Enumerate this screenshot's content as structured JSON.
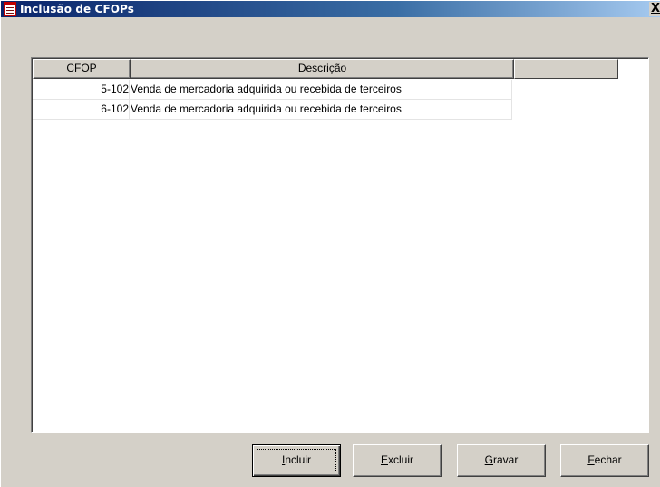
{
  "window": {
    "title": "Inclusão de CFOPs",
    "close_label": "X"
  },
  "table": {
    "columns": [
      "CFOP",
      "Descrição"
    ],
    "rows": [
      {
        "cfop": "5-102",
        "descricao": "Venda de mercadoria adquirida ou recebida de terceiros"
      },
      {
        "cfop": "6-102",
        "descricao": "Venda de mercadoria adquirida ou recebida de terceiros"
      }
    ]
  },
  "buttons": {
    "incluir": {
      "mnemonic": "I",
      "rest": "ncluir"
    },
    "excluir": {
      "mnemonic": "E",
      "rest": "xcluir"
    },
    "gravar": {
      "mnemonic": "G",
      "rest": "ravar"
    },
    "fechar": {
      "mnemonic": "F",
      "rest": "echar"
    }
  },
  "icons": {
    "title_icon": "document-list-icon",
    "close_icon": "close-icon"
  }
}
